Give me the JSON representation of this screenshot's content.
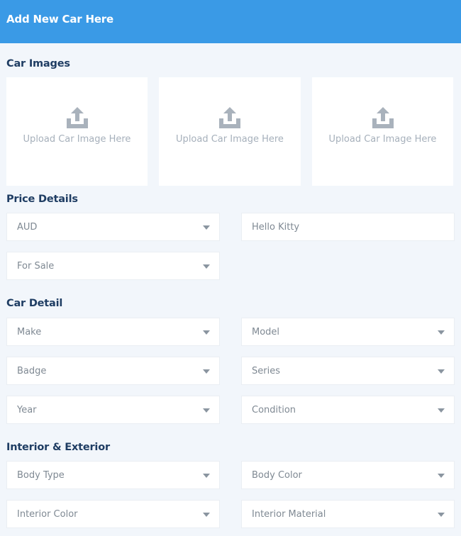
{
  "header": {
    "title": "Add New Car Here"
  },
  "sections": {
    "images": "Car Images",
    "price": "Price Details",
    "detail": "Car Detail",
    "interior": "Interior & Exterior"
  },
  "uploads": [
    {
      "label": "Upload Car Image Here",
      "icon": "upload-icon"
    },
    {
      "label": "Upload Car Image Here",
      "icon": "upload-icon"
    },
    {
      "label": "Upload Car Image Here",
      "icon": "upload-icon"
    }
  ],
  "price": {
    "currency": "AUD",
    "price_value": "Hello Kitty",
    "listing_type": "For Sale"
  },
  "car_detail": {
    "make": "Make",
    "model": "Model",
    "badge": "Badge",
    "series": "Series",
    "year": "Year",
    "condition": "Condition"
  },
  "interior_exterior": {
    "body_type": "Body Type",
    "body_color": "Body Color",
    "interior_color": "Interior Color",
    "interior_material": "Interior Material"
  },
  "colors": {
    "header_bg": "#3a9ae6",
    "section_title": "#1f3d63",
    "page_bg": "#f2f6fb"
  }
}
